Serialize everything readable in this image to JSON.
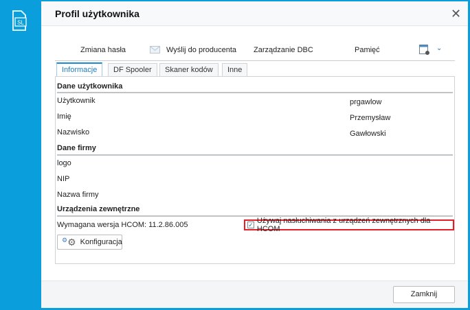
{
  "dialog": {
    "title": "Profil użytkownika",
    "app_icon_text": "SL"
  },
  "toolbar": {
    "items": [
      "Zmiana hasła",
      "Wyślij do producenta",
      "Zarządzanie DBC",
      "Pamięć"
    ]
  },
  "tabs": [
    {
      "label": "Informacje",
      "active": true
    },
    {
      "label": "DF Spooler"
    },
    {
      "label": "Skaner kodów"
    },
    {
      "label": "Inne"
    }
  ],
  "user_section": {
    "title": "Dane użytkownika",
    "rows": [
      {
        "label": "Użytkownik",
        "value": "prgawlow"
      },
      {
        "label": "Imię",
        "value": "Przemysław"
      },
      {
        "label": "Nazwisko",
        "value": "Gawłowski"
      }
    ]
  },
  "company_section": {
    "title": "Dane firmy",
    "rows": [
      {
        "label": "logo"
      },
      {
        "label": "NIP"
      },
      {
        "label": "Nazwa firmy"
      }
    ]
  },
  "devices_section": {
    "title": "Urządzenia zewnętrzne",
    "hcom_version": "Wymagana wersja HCOM: 11.2.86.005",
    "checkbox_label": "Używaj nasłuchiwania z urządzeń zewnętrznych dla HCOM",
    "checkbox_checked": true,
    "config_button": "Konfiguracja"
  },
  "footer": {
    "close_button": "Zamknij"
  },
  "colors": {
    "background": "#0a9fdc",
    "highlight": "#e41e26",
    "accent": "#1b8ad3"
  }
}
